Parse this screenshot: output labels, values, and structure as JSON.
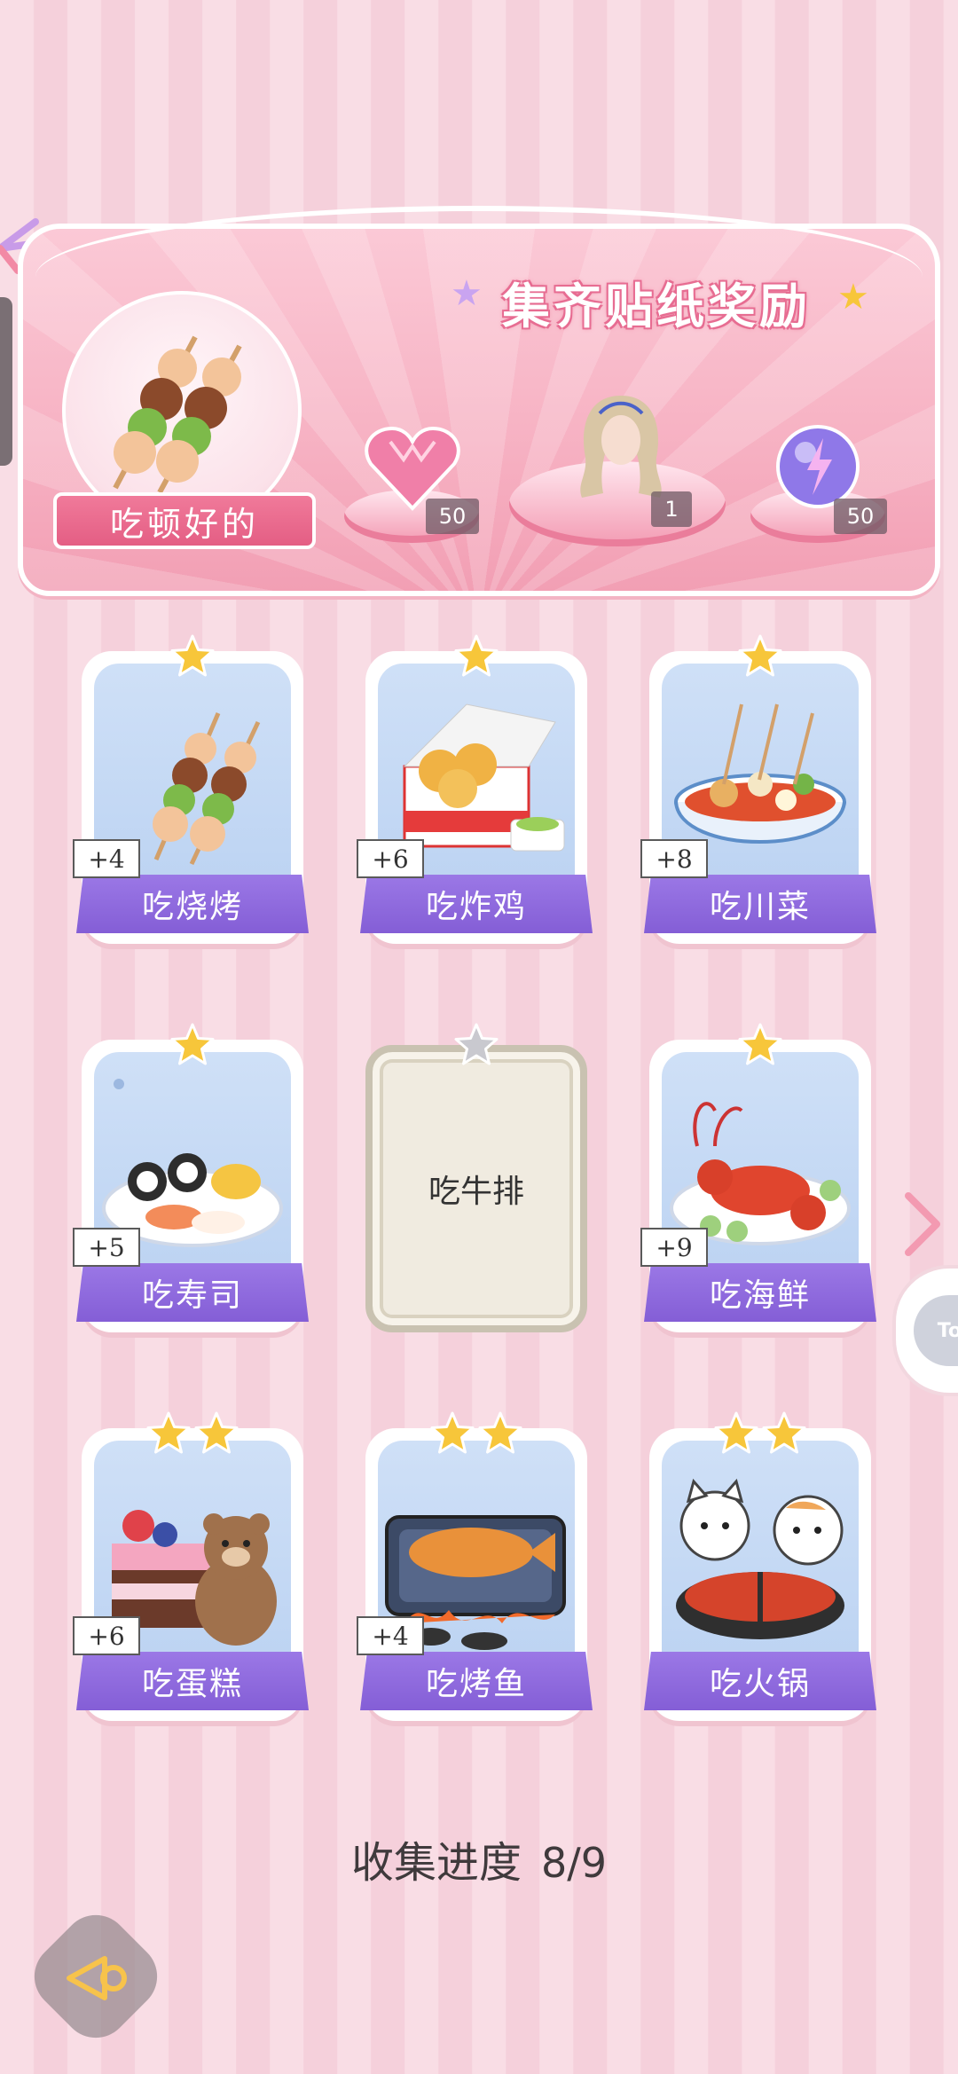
{
  "banner": {
    "title": "集齐贴纸奖励",
    "hero_label": "吃顿好的",
    "rewards": [
      {
        "name": "pink-diamond-heart",
        "count": "50"
      },
      {
        "name": "hairstyle",
        "count": "1"
      },
      {
        "name": "energy-orb",
        "count": "50"
      }
    ]
  },
  "cards": [
    {
      "label": "吃烧烤",
      "bonus": "+4",
      "stars": 1,
      "unlocked": true
    },
    {
      "label": "吃炸鸡",
      "bonus": "+6",
      "stars": 1,
      "unlocked": true
    },
    {
      "label": "吃川菜",
      "bonus": "+8",
      "stars": 1,
      "unlocked": true
    },
    {
      "label": "吃寿司",
      "bonus": "+5",
      "stars": 1,
      "unlocked": true
    },
    {
      "label": "吃牛排",
      "bonus": "",
      "stars": 1,
      "unlocked": false
    },
    {
      "label": "吃海鲜",
      "bonus": "+9",
      "stars": 1,
      "unlocked": true
    },
    {
      "label": "吃蛋糕",
      "bonus": "+6",
      "stars": 2,
      "unlocked": true
    },
    {
      "label": "吃烤鱼",
      "bonus": "+4",
      "stars": 2,
      "unlocked": true
    },
    {
      "label": "吃火锅",
      "bonus": "",
      "stars": 2,
      "unlocked": true
    }
  ],
  "progress": {
    "label": "收集进度",
    "value": "8/9"
  },
  "colors": {
    "accent_purple": "#8a63d9",
    "banner_pink": "#f7b3c4",
    "star_gold": "#f7c63a"
  }
}
